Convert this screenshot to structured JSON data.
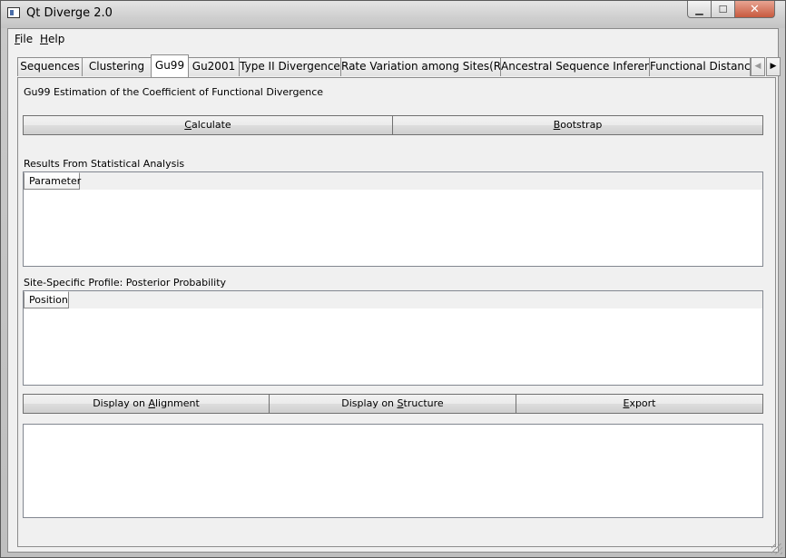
{
  "window": {
    "title": "Qt Diverge 2.0",
    "close_glyph": "✕",
    "min_glyph": "▁",
    "max_glyph": "☐"
  },
  "menu": {
    "file_key": "F",
    "file_rest": "ile",
    "help_key": "H",
    "help_rest": "elp"
  },
  "tabs": [
    {
      "label": "Sequences"
    },
    {
      "label": "Clustering"
    },
    {
      "label": "Gu99"
    },
    {
      "label": "Gu2001"
    },
    {
      "label": "Type II Divergence"
    },
    {
      "label": "Rate Variation among Sites(RVS)"
    },
    {
      "label": "Ancestral Sequence Inference"
    },
    {
      "label": "Functional Distance"
    }
  ],
  "active_tab": "Gu99",
  "tab_scroll": {
    "left": "◀",
    "right": "▶"
  },
  "page": {
    "heading": "Gu99 Estimation of the Coefficient of Functional Divergence",
    "calculate_key": "C",
    "calculate_rest": "alculate",
    "bootstrap_key": "B",
    "bootstrap_rest": "ootstrap",
    "results_label": "Results From Statistical Analysis",
    "results_header": "Parameter",
    "profile_label": "Site-Specific Profile: Posterior Probability",
    "profile_header": "Position",
    "display_alignment_pre": "Display on ",
    "display_alignment_key": "A",
    "display_alignment_rest": "lignment",
    "display_structure_pre": "Display on ",
    "display_structure_key": "S",
    "display_structure_rest": "tructure",
    "export_key": "E",
    "export_rest": "xport"
  }
}
